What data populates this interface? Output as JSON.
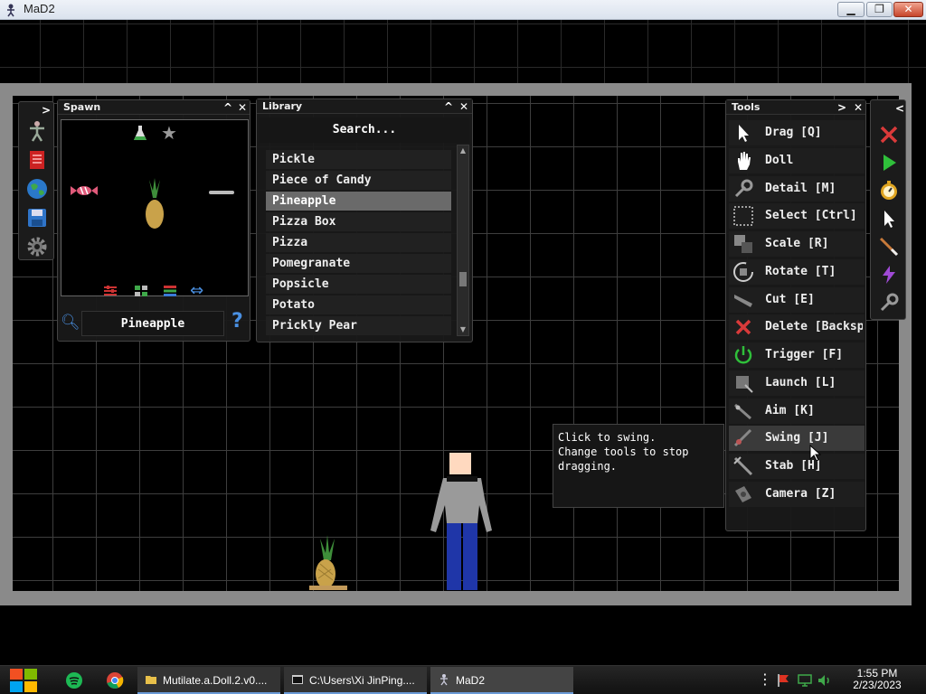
{
  "window": {
    "title": "MaD2"
  },
  "spawn": {
    "title": "Spawn",
    "selected_name": "Pineapple",
    "collapse_label": "^",
    "close_label": "✕"
  },
  "library": {
    "title": "Library",
    "search_placeholder": "Search...",
    "items": [
      "Pickle",
      "Piece of Candy",
      "Pineapple",
      "Pizza Box",
      "Pizza",
      "Pomegranate",
      "Popsicle",
      "Potato",
      "Prickly Pear"
    ],
    "selected_index": 2,
    "collapse_label": "^",
    "close_label": "✕"
  },
  "tools": {
    "title": "Tools",
    "expand_label": ">",
    "close_label": "✕",
    "items": [
      {
        "label": "Drag [Q]",
        "icon": "cursor-arrow-icon"
      },
      {
        "label": "Doll",
        "icon": "hand-icon"
      },
      {
        "label": "Detail [M]",
        "icon": "wrench-icon"
      },
      {
        "label": "Select [Ctrl]",
        "icon": "selection-box-icon"
      },
      {
        "label": "Scale [R]",
        "icon": "scale-icon"
      },
      {
        "label": "Rotate [T]",
        "icon": "rotate-icon"
      },
      {
        "label": "Cut [E]",
        "icon": "knife-icon"
      },
      {
        "label": "Delete [Backsp",
        "icon": "red-x-icon"
      },
      {
        "label": "Trigger [F]",
        "icon": "power-icon"
      },
      {
        "label": "Launch [L]",
        "icon": "launch-icon"
      },
      {
        "label": "Aim [K]",
        "icon": "aim-icon"
      },
      {
        "label": "Swing [J]",
        "icon": "swing-icon"
      },
      {
        "label": "Stab [H]",
        "icon": "stab-icon"
      },
      {
        "label": "Camera [Z]",
        "icon": "camera-icon"
      }
    ],
    "hovered_index": 11
  },
  "tooltip": {
    "line1": "Click to swing.",
    "line2": "Change tools to stop",
    "line3": "dragging."
  },
  "left_strip": {
    "expand_label": ">"
  },
  "right_strip": {
    "collapse_label": "<"
  },
  "taskbar": {
    "tasks": [
      "Mutilate.a.Doll.2.v0....",
      "C:\\Users\\Xi JinPing....",
      "MaD2"
    ],
    "time": "1:55 PM",
    "date": "2/23/2023"
  },
  "colors": {
    "delete_red": "#d93a3a",
    "play_green": "#2fbf3a",
    "accent_blue": "#4a90e2"
  }
}
